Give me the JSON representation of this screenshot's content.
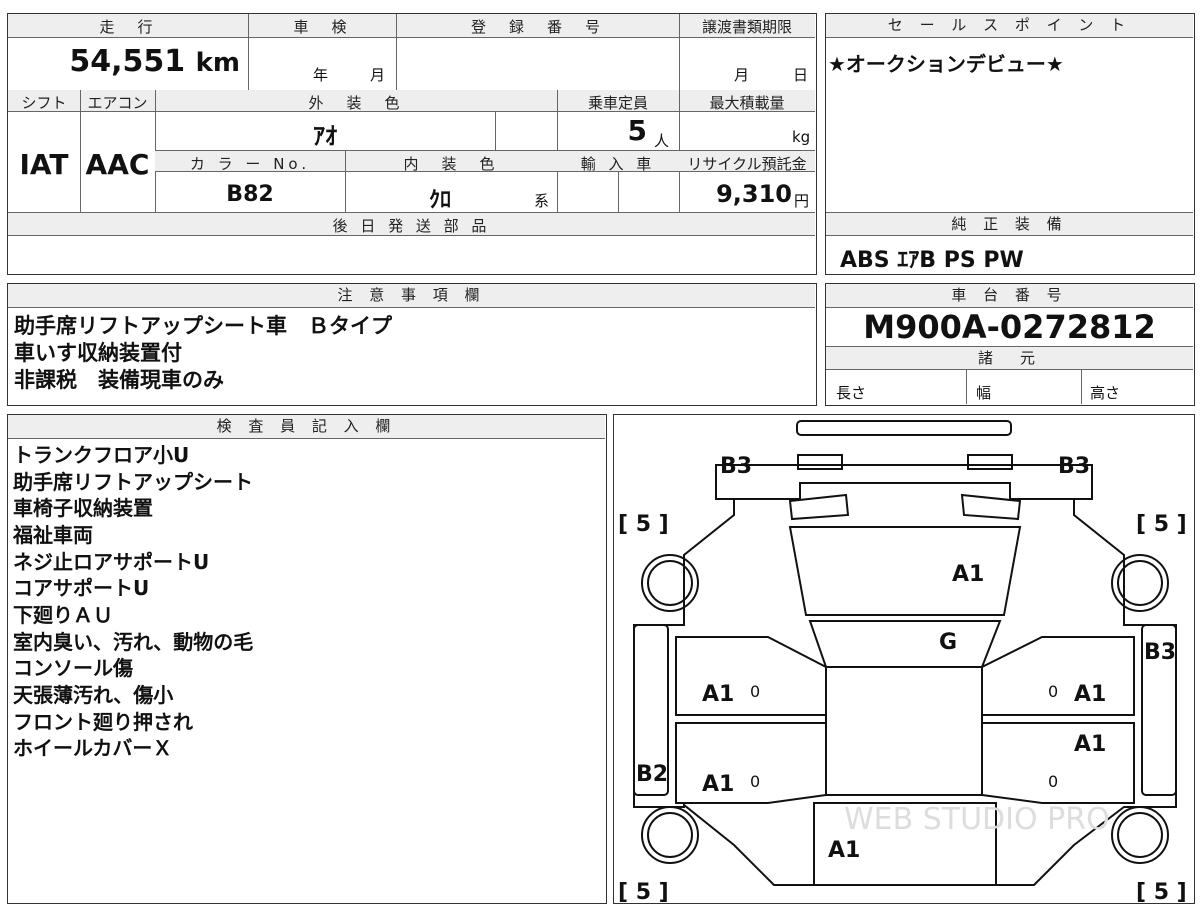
{
  "top_row": {
    "mileage_header": "走　行",
    "mileage": "54,551",
    "mileage_unit": "km",
    "shaken_header": "車　検",
    "shaken_year": "年",
    "shaken_month": "月",
    "reg_header": "登　録　番　号",
    "transfer_header": "譲渡書類期限",
    "transfer_month": "月",
    "transfer_day": "日"
  },
  "second_row": {
    "shift_header": "シフト",
    "aircon_header": "エアコン",
    "exterior_header": "外　装　色",
    "capacity_header": "乗車定員",
    "maxload_header": "最大積載量",
    "shift": "IAT",
    "aircon": "AAC",
    "exterior_color": "ｱｵ",
    "capacity": "5",
    "capacity_unit": "人",
    "maxload_unit": "kg",
    "color_no_header": "カ ラ ー No.",
    "interior_header": "内　装　色",
    "import_header": "輸 入 車",
    "recycle_header": "リサイクル預託金",
    "color_no": "B82",
    "interior_color": "ｸﾛ",
    "interior_suffix": "系",
    "recycle_fee": "9,310",
    "recycle_unit": "円"
  },
  "later_parts": {
    "header": "後 日 発 送 部 品",
    "value": ""
  },
  "sales_point": {
    "header": "セ ー ル ス ポ イ ン ト",
    "text": "★オークションデビュー★"
  },
  "genuine_equipment": {
    "header": "純 正 装 備",
    "text": "ABS ｴｱB PS PW"
  },
  "notes": {
    "header": "注 意 事 項 欄",
    "lines": [
      "助手席リフトアップシート車　Ｂタイプ",
      "車いす収納装置付",
      "非課税　装備現車のみ"
    ]
  },
  "chassis": {
    "header": "車 台 番 号",
    "number": "M900A-0272812",
    "specs_header": "諸　元",
    "length_label": "長さ",
    "width_label": "幅",
    "height_label": "高さ"
  },
  "inspector": {
    "header": "検 査 員 記 入 欄",
    "lines": [
      "トランクフロア小U",
      "助手席リフトアップシート",
      "車椅子収納装置",
      "福祉車両",
      "ネジ止ロアサポートU",
      "コアサポートU",
      "下廻りＡＵ",
      "室内臭い、汚れ、動物の毛",
      "コンソール傷",
      "天張薄汚れ、傷小",
      "フロント廻り押され",
      "ホイールカバーＸ"
    ]
  },
  "diagram": {
    "marks": {
      "rear_left": "B3",
      "rear_right": "B3",
      "tire_rl": "[ 5 ]",
      "tire_rr": "[ 5 ]",
      "tire_fl": "[ 5 ]",
      "tire_fr": "[ 5 ]",
      "roof": "A1",
      "rear_glass": "G",
      "door_rl": "A1",
      "door_rr": "A1",
      "door_fl": "A1",
      "door_fr": "A1",
      "side_right": "B3",
      "side_left": "B2",
      "hood": "A1",
      "zero_1": "0",
      "zero_2": "0",
      "zero_3": "0",
      "zero_4": "0"
    },
    "watermark": "WEB STUDIO PRO"
  }
}
